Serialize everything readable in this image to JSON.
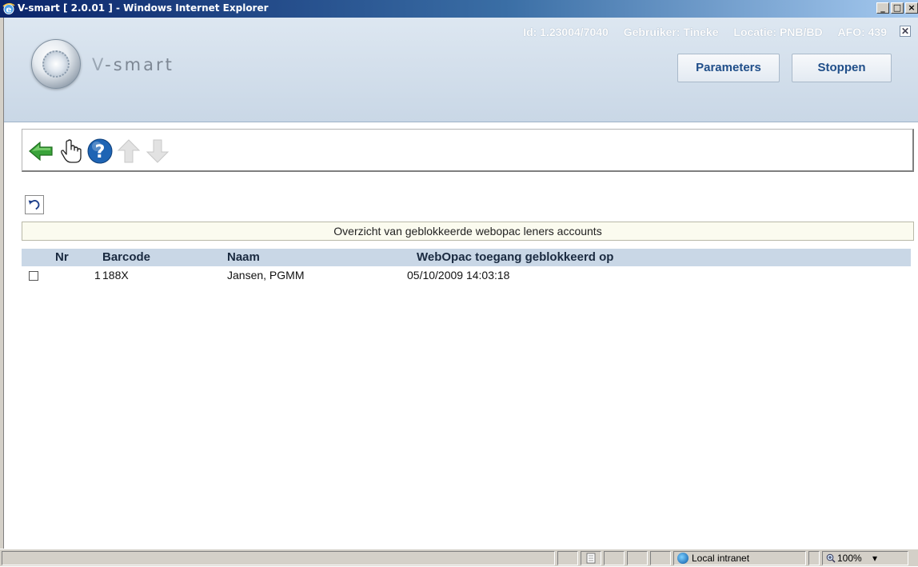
{
  "window": {
    "title": "V-smart [ 2.0.01 ] - Windows Internet Explorer",
    "controls": {
      "minimize": "_",
      "maximize": "□",
      "close": "×"
    }
  },
  "header": {
    "brand": "V-smart",
    "brand_v": "V",
    "brand_rest": "-smart",
    "id_label": "Id: 1.23004/7040",
    "user_label": "Gebruiker: Tineke",
    "location_label": "Locatie: PNB/BD",
    "afo_label": "AFO: 439",
    "close_glyph": "✕",
    "buttons": {
      "parameters": "Parameters",
      "stop": "Stoppen"
    }
  },
  "toolbar": {
    "icons": [
      "back-arrow-icon",
      "hand-pointer-icon",
      "help-icon",
      "arrow-up-icon",
      "arrow-down-icon"
    ]
  },
  "undo_icon": "undo-icon",
  "caption": "Overzicht van geblokkeerde webopac leners accounts",
  "table": {
    "columns": [
      "Nr",
      "Barcode",
      "Naam",
      "WebOpac toegang geblokkeerd op"
    ],
    "rows": [
      {
        "nr": "1",
        "barcode": "188X",
        "naam": "Jansen, PGMM",
        "blocked_on": "05/10/2009 14:03:18",
        "checked": false
      }
    ]
  },
  "statusbar": {
    "zone": "Local intranet",
    "zoom": "100%",
    "zoom_arrow": "▾"
  },
  "colors": {
    "title_gradient_start": "#0a246a",
    "header_bg": "#c9d7e6",
    "button_text": "#1f4e89",
    "back_arrow": "#3aa33a",
    "help": "#1e64b4",
    "disabled_arrow": "#c8c8c8"
  }
}
